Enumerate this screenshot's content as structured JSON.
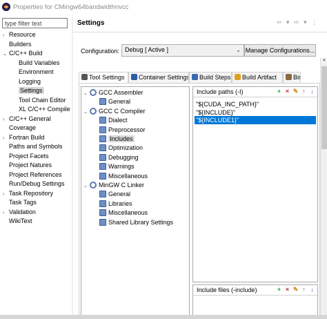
{
  "window": {
    "title": "Properties for CMingw64bandwidthnvcc"
  },
  "filter": {
    "placeholder": "type filter text"
  },
  "left_tree": [
    {
      "label": "Resource",
      "indent": 0,
      "expander": "›"
    },
    {
      "label": "Builders",
      "indent": 0,
      "expander": ""
    },
    {
      "label": "C/C++ Build",
      "indent": 0,
      "expander": "⌄"
    },
    {
      "label": "Build Variables",
      "indent": 1,
      "expander": ""
    },
    {
      "label": "Environment",
      "indent": 1,
      "expander": ""
    },
    {
      "label": "Logging",
      "indent": 1,
      "expander": ""
    },
    {
      "label": "Settings",
      "indent": 1,
      "expander": "",
      "selected": true
    },
    {
      "label": "Tool Chain Editor",
      "indent": 1,
      "expander": ""
    },
    {
      "label": "XL C/C++ Compile",
      "indent": 1,
      "expander": ""
    },
    {
      "label": "C/C++ General",
      "indent": 0,
      "expander": "›"
    },
    {
      "label": "Coverage",
      "indent": 0,
      "expander": ""
    },
    {
      "label": "Fortran Build",
      "indent": 0,
      "expander": "›"
    },
    {
      "label": "Paths and Symbols",
      "indent": 0,
      "expander": ""
    },
    {
      "label": "Project Facets",
      "indent": 0,
      "expander": ""
    },
    {
      "label": "Project Natures",
      "indent": 0,
      "expander": ""
    },
    {
      "label": "Project References",
      "indent": 0,
      "expander": ""
    },
    {
      "label": "Run/Debug Settings",
      "indent": 0,
      "expander": ""
    },
    {
      "label": "Task Repository",
      "indent": 0,
      "expander": "›"
    },
    {
      "label": "Task Tags",
      "indent": 0,
      "expander": ""
    },
    {
      "label": "Validation",
      "indent": 0,
      "expander": "›"
    },
    {
      "label": "WikiText",
      "indent": 0,
      "expander": ""
    }
  ],
  "header": {
    "title": "Settings",
    "nav": "⇦ ▾ ⇨ ▾ ⋮"
  },
  "configuration": {
    "label": "Configuration:",
    "value": "Debug  [ Active ]",
    "manage_label": "Manage Configurations..."
  },
  "tabs": [
    {
      "label": "Tool Settings",
      "icon": "tool-settings-icon",
      "active": true
    },
    {
      "label": "Container Settings",
      "icon": "container-icon"
    },
    {
      "label": "Build Steps",
      "icon": "build-steps-icon"
    },
    {
      "label": "Build Artifact",
      "icon": "build-artifact-icon"
    },
    {
      "label": "Bin",
      "icon": "binary-parsers-icon"
    }
  ],
  "tool_tree": [
    {
      "label": "GCC Assembler",
      "indent": 0,
      "expander": "⌄",
      "icon": "tool-gear-icon"
    },
    {
      "label": "General",
      "indent": 1,
      "icon": "option-category-icon"
    },
    {
      "label": "GCC C Compiler",
      "indent": 0,
      "expander": "⌄",
      "icon": "tool-gear-icon"
    },
    {
      "label": "Dialect",
      "indent": 1,
      "icon": "option-category-icon"
    },
    {
      "label": "Preprocessor",
      "indent": 1,
      "icon": "option-category-icon"
    },
    {
      "label": "Includes",
      "indent": 1,
      "icon": "option-category-icon",
      "selected": true
    },
    {
      "label": "Optimization",
      "indent": 1,
      "icon": "option-category-icon"
    },
    {
      "label": "Debugging",
      "indent": 1,
      "icon": "option-category-icon"
    },
    {
      "label": "Warnings",
      "indent": 1,
      "icon": "option-category-icon"
    },
    {
      "label": "Miscellaneous",
      "indent": 1,
      "icon": "option-category-icon"
    },
    {
      "label": "MinGW C Linker",
      "indent": 0,
      "expander": "⌄",
      "icon": "tool-gear-icon"
    },
    {
      "label": "General",
      "indent": 1,
      "icon": "option-category-icon"
    },
    {
      "label": "Libraries",
      "indent": 1,
      "icon": "option-category-icon"
    },
    {
      "label": "Miscellaneous",
      "indent": 1,
      "icon": "option-category-icon"
    },
    {
      "label": "Shared Library Settings",
      "indent": 1,
      "icon": "option-category-icon"
    }
  ],
  "include_paths": {
    "title": "Include paths (-I)",
    "items": [
      {
        "value": "\"${CUDA_INC_PATH}\""
      },
      {
        "value": "\"${INCLUDE}\""
      },
      {
        "value": "\"${INCLUDE1}\"",
        "selected": true
      }
    ]
  },
  "include_files": {
    "title": "Include files (-include)"
  },
  "colors": {
    "selection": "#0078d7",
    "tree_selection": "#d9d9d9"
  }
}
